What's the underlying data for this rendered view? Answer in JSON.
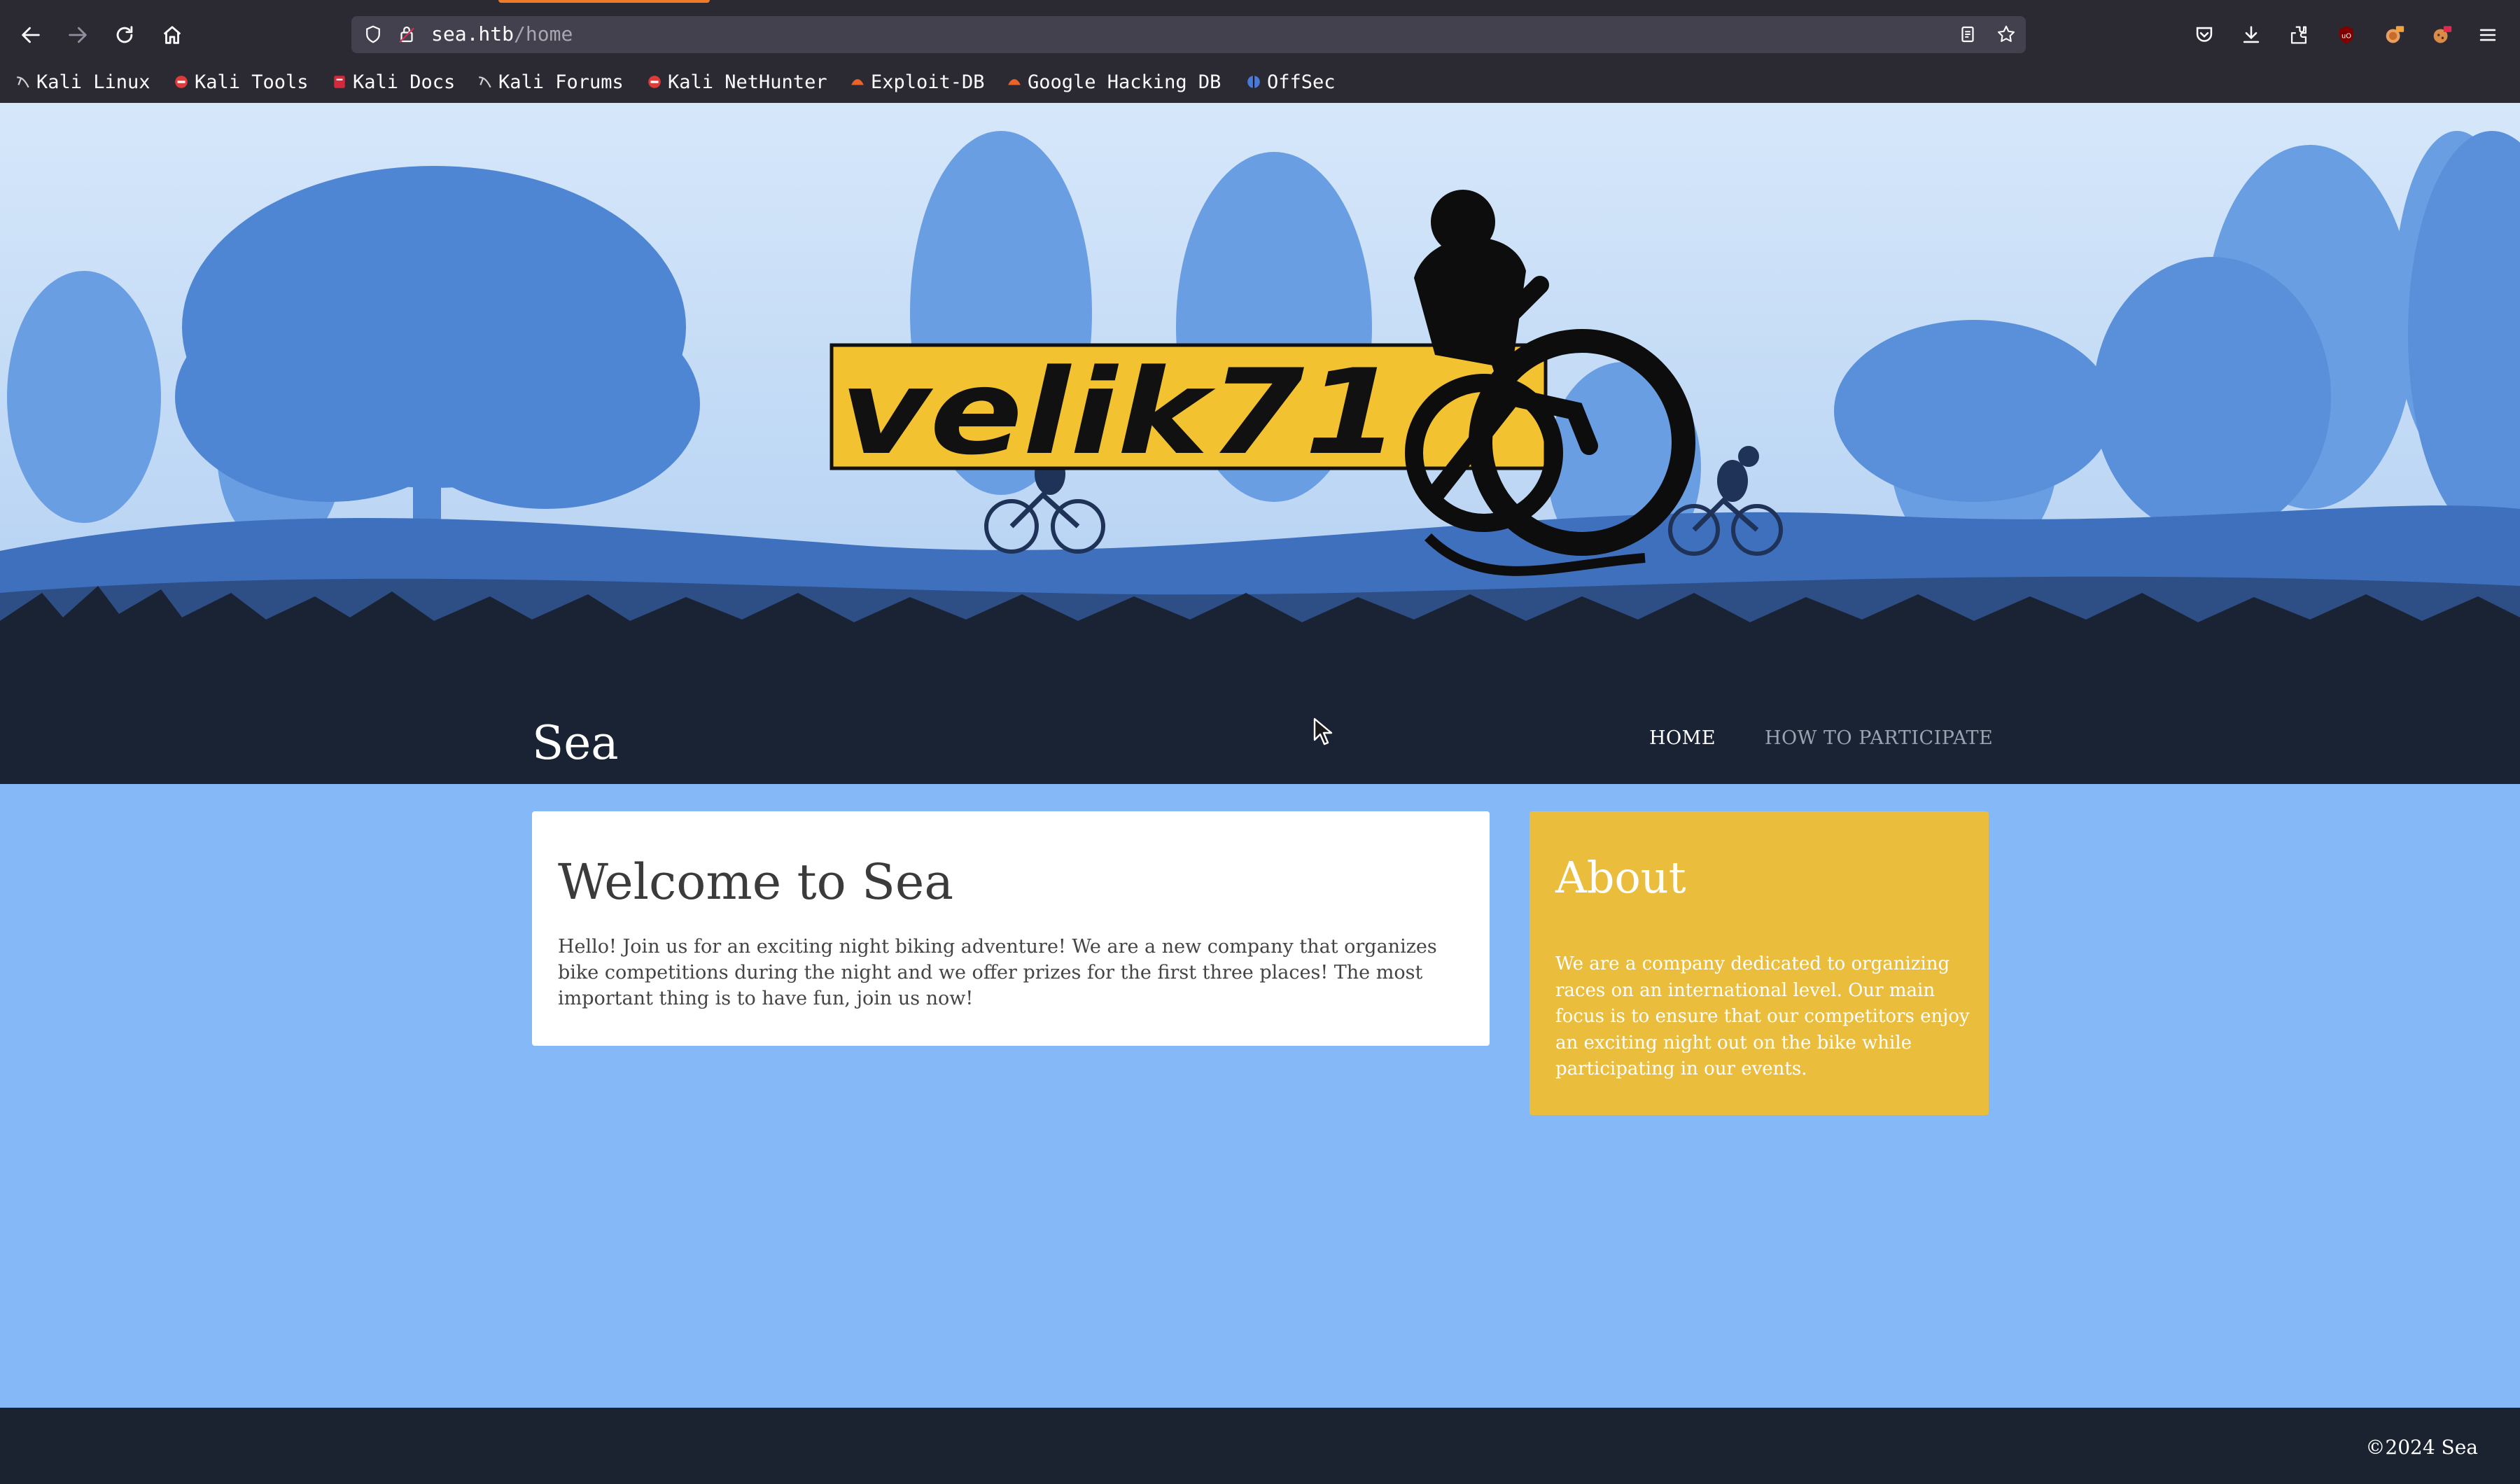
{
  "browser": {
    "url_host": "sea.htb",
    "url_path": "/home",
    "bookmarks": [
      {
        "label": "Kali Linux",
        "icon": "kali-dragon-icon"
      },
      {
        "label": "Kali Tools",
        "icon": "kali-tools-icon"
      },
      {
        "label": "Kali Docs",
        "icon": "kali-docs-icon"
      },
      {
        "label": "Kali Forums",
        "icon": "kali-dragon-icon"
      },
      {
        "label": "Kali NetHunter",
        "icon": "kali-tools-icon"
      },
      {
        "label": "Exploit-DB",
        "icon": "exploit-db-icon"
      },
      {
        "label": "Google Hacking DB",
        "icon": "exploit-db-icon"
      },
      {
        "label": "OffSec",
        "icon": "offsec-icon"
      }
    ]
  },
  "site": {
    "logo_text": "velik71",
    "title": "Sea",
    "nav": {
      "home": "HOME",
      "participate": "HOW TO PARTICIPATE"
    }
  },
  "welcome": {
    "heading": "Welcome to Sea",
    "body": "Hello! Join us for an exciting night biking adventure! We are a new company that organizes bike competitions during the night and we offer prizes for the first three places! The most important thing is to have fun, join us now!"
  },
  "about": {
    "heading": "About",
    "body": "We are a company dedicated to organizing races on an international level. Our main focus is to ensure that our competitors enjoy an exciting night out on the bike while participating in our events."
  },
  "footer": {
    "copyright": "©2024 Sea"
  },
  "colors": {
    "page_bg": "#84b8f7",
    "header_dark": "#1a2333",
    "about_card": "#ebbd3d",
    "logo_yellow": "#f2c230",
    "sky": "#d6e7fa"
  }
}
